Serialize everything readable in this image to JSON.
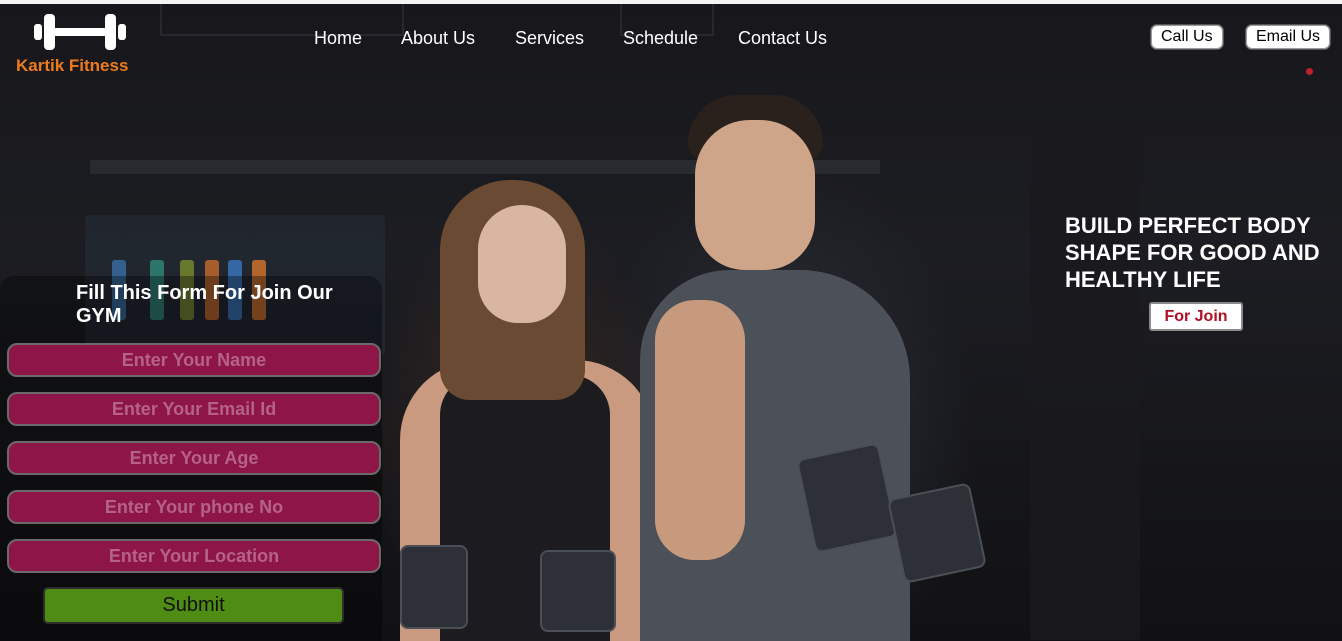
{
  "brand": {
    "name": "Kartik Fitness",
    "icon": "dumbbell-icon",
    "color": "#ee7a1e"
  },
  "nav": {
    "items": [
      {
        "label": "Home"
      },
      {
        "label": "About Us"
      },
      {
        "label": "Services"
      },
      {
        "label": "Schedule"
      },
      {
        "label": "Contact Us"
      }
    ]
  },
  "header_actions": {
    "call_label": "Call Us",
    "email_label": "Email Us"
  },
  "hero": {
    "headline": "BUILD PERFECT BODY SHAPE FOR GOOD AND HEALTHY LIFE",
    "join_label": "For Join",
    "join_color": "#b01025"
  },
  "form": {
    "title": "Fill This Form For Join Our GYM",
    "fields": [
      {
        "placeholder": "Enter Your Name"
      },
      {
        "placeholder": "Enter Your Email Id"
      },
      {
        "placeholder": "Enter Your Age"
      },
      {
        "placeholder": "Enter Your phone No"
      },
      {
        "placeholder": "Enter Your Location"
      }
    ],
    "field_color": "#8e1548",
    "submit_label": "Submit",
    "submit_color": "#4e8c14"
  }
}
